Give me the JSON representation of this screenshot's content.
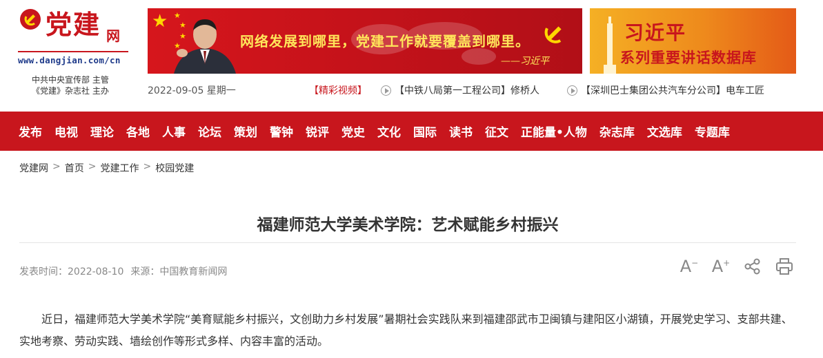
{
  "logo": {
    "text": "党建",
    "sub": "网",
    "url": "www.dangjian.com/cn",
    "org_line1": "中共中央宣传部 主管",
    "org_line2": "《党建》杂志社 主办"
  },
  "banner1": {
    "slogan": "网络发展到哪里，党建工作就要覆盖到哪里。",
    "signature": "——习近平"
  },
  "banner2": {
    "title": "习近平",
    "subtitle": "系列重要讲话数据库"
  },
  "topbar": {
    "date": "2022-09-05 星期一",
    "video_label": "【精彩视频】",
    "videos": [
      "【中铁八局第一工程公司】修桥人",
      "【深圳巴士集团公共汽车分公司】电车工匠"
    ]
  },
  "nav": {
    "items": [
      "发布",
      "电视",
      "理论",
      "各地",
      "人事",
      "论坛",
      "策划",
      "警钟",
      "锐评",
      "党史",
      "文化",
      "国际",
      "读书",
      "征文",
      "正能量•人物",
      "杂志库",
      "文选库",
      "专题库"
    ]
  },
  "breadcrumb": {
    "items": [
      "党建网",
      "首页",
      "党建工作",
      "校园党建"
    ],
    "separator": ">"
  },
  "article": {
    "title": "福建师范大学美术学院：艺术赋能乡村振兴",
    "publish_label": "发表时间：",
    "publish_date": "2022-08-10",
    "source_label": "来源：",
    "source": "中国教育新闻网",
    "body": "近日，福建师范大学美术学院“美育赋能乡村振兴，文创助力乡村发展”暑期社会实践队来到福建邵武市卫闽镇与建阳区小湖镇，开展党史学习、支部共建、实地考察、劳动实践、墙绘创作等形式多样、内容丰富的活动。"
  },
  "tools": {
    "font_decrease": "A",
    "font_decrease_sup": "−",
    "font_increase": "A",
    "font_increase_sup": "+"
  },
  "colors": {
    "brand_red": "#c8161d",
    "banner_yellow": "#ffe65a",
    "url_blue": "#1e3a8a"
  }
}
